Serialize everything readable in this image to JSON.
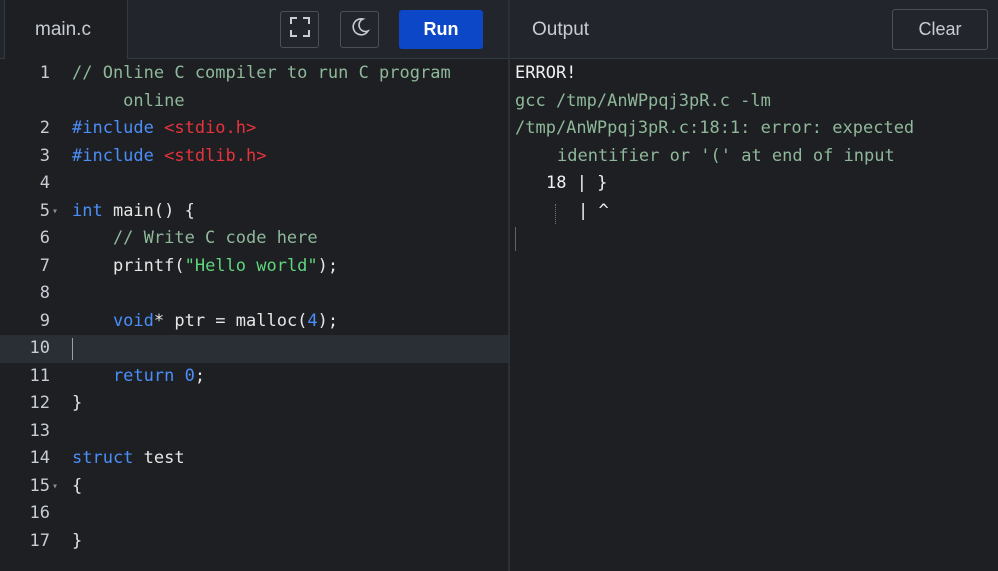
{
  "editor": {
    "filename": "main.c",
    "run_label": "Run",
    "lines": [
      {
        "num": "1",
        "fold": "",
        "tokens": [
          {
            "t": "// Online C compiler to run C program",
            "c": "c-comment"
          }
        ]
      },
      {
        "num": "",
        "fold": "",
        "tokens": [
          {
            "t": "     online",
            "c": "c-comment"
          }
        ]
      },
      {
        "num": "2",
        "fold": "",
        "tokens": [
          {
            "t": "#include ",
            "c": "c-kw"
          },
          {
            "t": "<stdio.h>",
            "c": "c-inc"
          }
        ]
      },
      {
        "num": "3",
        "fold": "",
        "tokens": [
          {
            "t": "#include ",
            "c": "c-kw"
          },
          {
            "t": "<stdlib.h>",
            "c": "c-inc"
          }
        ]
      },
      {
        "num": "4",
        "fold": "",
        "tokens": []
      },
      {
        "num": "5",
        "fold": "▾",
        "tokens": [
          {
            "t": "int",
            "c": "c-kw"
          },
          {
            "t": " main() {",
            "c": "c-plain"
          }
        ]
      },
      {
        "num": "6",
        "fold": "",
        "tokens": [
          {
            "t": "    // Write C code here",
            "c": "c-comment"
          }
        ]
      },
      {
        "num": "7",
        "fold": "",
        "tokens": [
          {
            "t": "    printf(",
            "c": "c-plain"
          },
          {
            "t": "\"Hello world\"",
            "c": "c-str"
          },
          {
            "t": ");",
            "c": "c-plain"
          }
        ]
      },
      {
        "num": "8",
        "fold": "",
        "tokens": []
      },
      {
        "num": "9",
        "fold": "",
        "tokens": [
          {
            "t": "    void",
            "c": "c-kw"
          },
          {
            "t": "* ptr = malloc(",
            "c": "c-plain"
          },
          {
            "t": "4",
            "c": "c-num"
          },
          {
            "t": ");",
            "c": "c-plain"
          }
        ]
      },
      {
        "num": "10",
        "fold": "",
        "tokens": [],
        "active": true
      },
      {
        "num": "11",
        "fold": "",
        "tokens": [
          {
            "t": "    return ",
            "c": "c-kw"
          },
          {
            "t": "0",
            "c": "c-num"
          },
          {
            "t": ";",
            "c": "c-plain"
          }
        ]
      },
      {
        "num": "12",
        "fold": "",
        "tokens": [
          {
            "t": "}",
            "c": "c-plain"
          }
        ]
      },
      {
        "num": "13",
        "fold": "",
        "tokens": []
      },
      {
        "num": "14",
        "fold": "",
        "tokens": [
          {
            "t": "struct",
            "c": "c-kw"
          },
          {
            "t": " test",
            "c": "c-plain"
          }
        ]
      },
      {
        "num": "15",
        "fold": "▾",
        "tokens": [
          {
            "t": "{",
            "c": "c-plain"
          }
        ]
      },
      {
        "num": "16",
        "fold": "",
        "tokens": []
      },
      {
        "num": "17",
        "fold": "",
        "tokens": [
          {
            "t": "}",
            "c": "c-plain"
          }
        ]
      }
    ]
  },
  "output": {
    "title": "Output",
    "clear_label": "Clear",
    "lines": [
      {
        "text": "ERROR!",
        "cls": "out-err",
        "indent": "0"
      },
      {
        "text": "gcc /tmp/AnWPpqj3pR.c -lm",
        "cls": "out-cmd",
        "indent": "0"
      },
      {
        "text": "/tmp/AnWPpqj3pR.c:18:1: error: expected",
        "cls": "out-cmd",
        "indent": "0"
      },
      {
        "text": "identifier or '(' at end of input",
        "cls": "out-cmd",
        "indent": "1"
      },
      {
        "text": "18 | }",
        "cls": "out-src",
        "indent": "2"
      },
      {
        "text": "| ^",
        "cls": "out-src",
        "indent": "3"
      }
    ]
  },
  "icons": {
    "fullscreen": "fullscreen-icon",
    "theme": "moon-icon"
  },
  "colors": {
    "run_button": "#0b47c7",
    "keyword": "#4b8ef8",
    "include": "#e8333c",
    "string": "#5ed67c",
    "comment": "#8fb89a"
  }
}
